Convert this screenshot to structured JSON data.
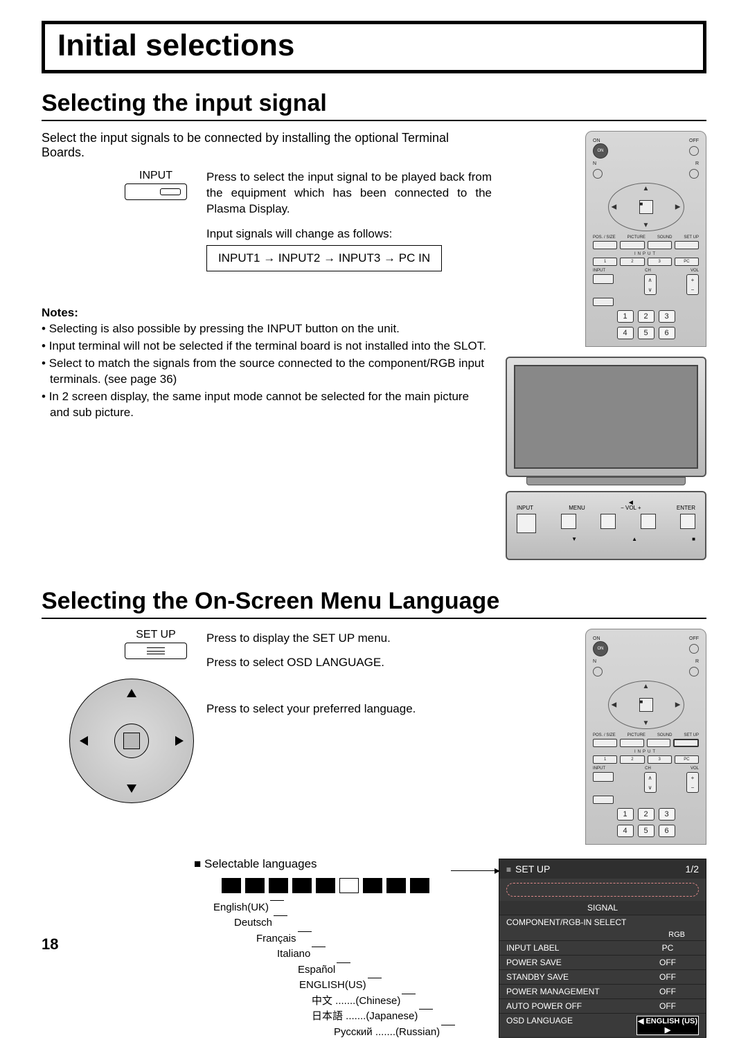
{
  "page_number": "18",
  "title": "Initial selections",
  "section1": {
    "heading": "Selecting the input signal",
    "intro": "Select the input signals to be connected by installing the optional Terminal Boards.",
    "button_label": "INPUT",
    "button_text": "Press to select the input signal to be played back from the equipment which has been connected to the Plasma Display.",
    "flow_label": "Input signals will change as follows:",
    "flow_items": [
      "INPUT1",
      "INPUT2",
      "INPUT3",
      "PC IN"
    ],
    "notes_title": "Notes:",
    "notes": [
      "Selecting is also possible by pressing the INPUT button on the unit.",
      "Input terminal will not be selected if the terminal board is not installed into the SLOT.",
      "Select to match the signals from the source connected to the component/RGB input terminals. (see page 36)",
      "In 2 screen display, the same input mode cannot be selected for the main picture and sub picture."
    ],
    "tv_panel_labels": [
      "INPUT",
      "MENU",
      "−  VOL  +",
      "ENTER"
    ]
  },
  "section2": {
    "heading": "Selecting the On-Screen Menu Language",
    "button_label": "SET UP",
    "step1": "Press to display the SET UP menu.",
    "step2": "Press to select OSD LANGUAGE.",
    "step3": "Press to select your preferred language.",
    "lang_head": "■ Selectable languages",
    "languages": [
      {
        "label": "English(UK)",
        "indent": 0
      },
      {
        "label": "Deutsch",
        "indent": 1
      },
      {
        "label": "Français",
        "indent": 2
      },
      {
        "label": "Italiano",
        "indent": 3
      },
      {
        "label": "Español",
        "indent": 4
      },
      {
        "label": "ENGLISH(US)",
        "indent": 5
      },
      {
        "label": "中文 .......(Chinese)",
        "indent": 6
      },
      {
        "label": "日本語 .......(Japanese)",
        "indent": 7
      },
      {
        "label": "Русский .......(Russian)",
        "indent": 8
      }
    ]
  },
  "osd": {
    "title": "SET UP",
    "page": "1/2",
    "signal": "SIGNAL",
    "rows": [
      {
        "k": "COMPONENT/RGB-IN SELECT",
        "v": ""
      },
      {
        "k": "",
        "v": "RGB",
        "rgb": true
      },
      {
        "k": "INPUT LABEL",
        "v": "PC"
      },
      {
        "k": "POWER SAVE",
        "v": "OFF"
      },
      {
        "k": "STANDBY SAVE",
        "v": "OFF"
      },
      {
        "k": "POWER MANAGEMENT",
        "v": "OFF"
      },
      {
        "k": "AUTO POWER OFF",
        "v": "OFF"
      },
      {
        "k": "OSD LANGUAGE",
        "v": "ENGLISH (US)",
        "high": true
      }
    ]
  },
  "remote": {
    "on": "ON",
    "off": "OFF",
    "n": "N",
    "r": "R",
    "menu_labels": [
      "POS. / SIZE",
      "PICTURE",
      "SOUND",
      "SET UP"
    ],
    "input_label": "INPUT",
    "input_nums": [
      "1",
      "2",
      "3",
      "PC"
    ],
    "input_btn": "INPUT",
    "ch": "CH",
    "vol": "VOL",
    "numpad": [
      "1",
      "2",
      "3",
      "4",
      "5",
      "6"
    ]
  }
}
